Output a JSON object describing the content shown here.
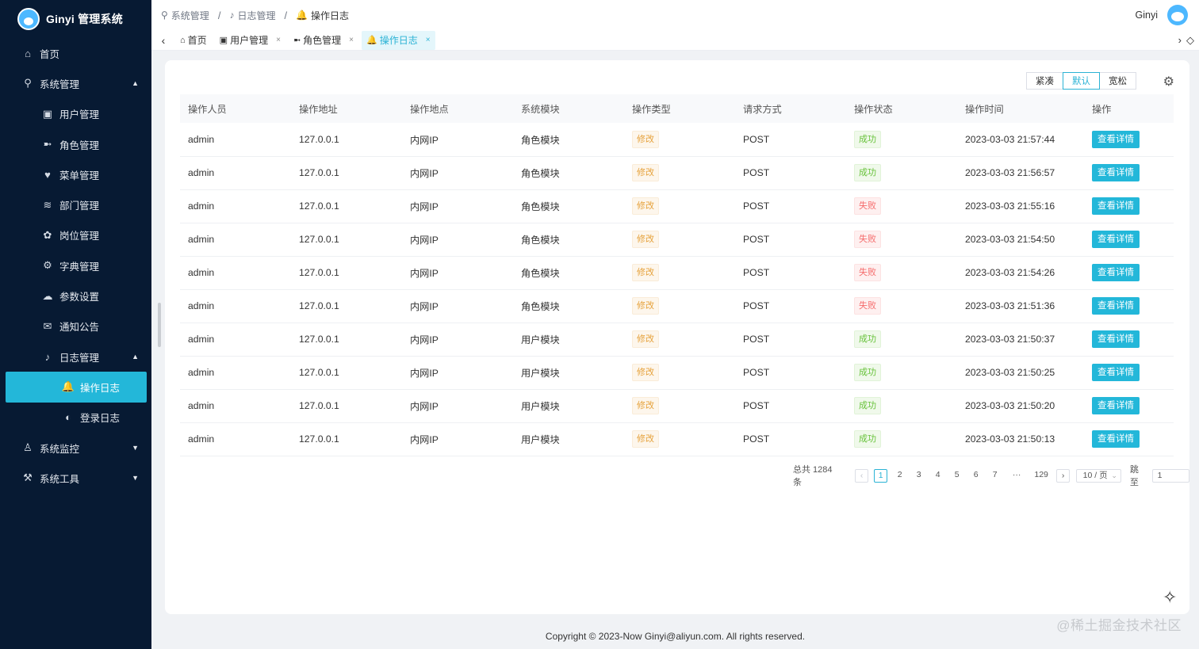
{
  "app": {
    "title": "Ginyi 管理系统"
  },
  "sidebar": {
    "items": [
      {
        "label": "首页",
        "icon": "home-icon",
        "glyph": "⌂",
        "level": 0
      },
      {
        "label": "系统管理",
        "icon": "person-icon",
        "glyph": "⚲",
        "level": 0,
        "expanded": true
      },
      {
        "label": "用户管理",
        "icon": "user-card-icon",
        "glyph": "▣",
        "level": 1
      },
      {
        "label": "角色管理",
        "icon": "role-icon",
        "glyph": "➼",
        "level": 1
      },
      {
        "label": "菜单管理",
        "icon": "heart-icon",
        "glyph": "♥",
        "level": 1
      },
      {
        "label": "部门管理",
        "icon": "layers-icon",
        "glyph": "≋",
        "level": 1
      },
      {
        "label": "岗位管理",
        "icon": "paw-icon",
        "glyph": "✿",
        "level": 1
      },
      {
        "label": "字典管理",
        "icon": "gear-icon",
        "glyph": "⚙",
        "level": 1
      },
      {
        "label": "参数设置",
        "icon": "wechat-icon",
        "glyph": "☁",
        "level": 1
      },
      {
        "label": "通知公告",
        "icon": "mail-icon",
        "glyph": "✉",
        "level": 1
      },
      {
        "label": "日志管理",
        "icon": "microphone-icon",
        "glyph": "♪",
        "level": 1,
        "expanded": true
      },
      {
        "label": "操作日志",
        "icon": "bell-icon",
        "glyph": "🔔",
        "level": 2,
        "active": true
      },
      {
        "label": "登录日志",
        "icon": "planet-icon",
        "glyph": "◐",
        "level": 2
      },
      {
        "label": "系统监控",
        "icon": "user-icon",
        "glyph": "♙",
        "level": 0,
        "collapsed": true
      },
      {
        "label": "系统工具",
        "icon": "wrench-icon",
        "glyph": "⚒",
        "level": 0,
        "collapsed": true
      }
    ]
  },
  "breadcrumb": [
    {
      "label": "系统管理",
      "icon": "person-icon",
      "glyph": "⚲"
    },
    {
      "label": "日志管理",
      "icon": "microphone-icon",
      "glyph": "♪"
    },
    {
      "label": "操作日志",
      "icon": "bell-icon",
      "glyph": "🔔"
    }
  ],
  "breadcrumb_separator": "/",
  "user": {
    "name": "Ginyi"
  },
  "tabs": [
    {
      "label": "首页",
      "icon": "home-icon",
      "glyph": "⌂",
      "closable": false
    },
    {
      "label": "用户管理",
      "icon": "user-card-icon",
      "glyph": "▣",
      "closable": true
    },
    {
      "label": "角色管理",
      "icon": "role-icon",
      "glyph": "➼",
      "closable": true
    },
    {
      "label": "操作日志",
      "icon": "bell-icon",
      "glyph": "🔔",
      "closable": true,
      "active": true
    }
  ],
  "density": {
    "options": [
      "紧凑",
      "默认",
      "宽松"
    ],
    "selected": "默认"
  },
  "table": {
    "columns": [
      "操作人员",
      "操作地址",
      "操作地点",
      "系统模块",
      "操作类型",
      "请求方式",
      "操作状态",
      "操作时间",
      "操作"
    ],
    "rows": [
      {
        "user": "admin",
        "ip": "127.0.0.1",
        "location": "内网IP",
        "module": "角色模块",
        "type": "修改",
        "method": "POST",
        "status": "成功",
        "status_kind": "ok",
        "time": "2023-03-03 21:57:44",
        "action": "查看详情"
      },
      {
        "user": "admin",
        "ip": "127.0.0.1",
        "location": "内网IP",
        "module": "角色模块",
        "type": "修改",
        "method": "POST",
        "status": "成功",
        "status_kind": "ok",
        "time": "2023-03-03 21:56:57",
        "action": "查看详情"
      },
      {
        "user": "admin",
        "ip": "127.0.0.1",
        "location": "内网IP",
        "module": "角色模块",
        "type": "修改",
        "method": "POST",
        "status": "失败",
        "status_kind": "fail",
        "time": "2023-03-03 21:55:16",
        "action": "查看详情"
      },
      {
        "user": "admin",
        "ip": "127.0.0.1",
        "location": "内网IP",
        "module": "角色模块",
        "type": "修改",
        "method": "POST",
        "status": "失败",
        "status_kind": "fail",
        "time": "2023-03-03 21:54:50",
        "action": "查看详情"
      },
      {
        "user": "admin",
        "ip": "127.0.0.1",
        "location": "内网IP",
        "module": "角色模块",
        "type": "修改",
        "method": "POST",
        "status": "失败",
        "status_kind": "fail",
        "time": "2023-03-03 21:54:26",
        "action": "查看详情"
      },
      {
        "user": "admin",
        "ip": "127.0.0.1",
        "location": "内网IP",
        "module": "角色模块",
        "type": "修改",
        "method": "POST",
        "status": "失败",
        "status_kind": "fail",
        "time": "2023-03-03 21:51:36",
        "action": "查看详情"
      },
      {
        "user": "admin",
        "ip": "127.0.0.1",
        "location": "内网IP",
        "module": "用户模块",
        "type": "修改",
        "method": "POST",
        "status": "成功",
        "status_kind": "ok",
        "time": "2023-03-03 21:50:37",
        "action": "查看详情"
      },
      {
        "user": "admin",
        "ip": "127.0.0.1",
        "location": "内网IP",
        "module": "用户模块",
        "type": "修改",
        "method": "POST",
        "status": "成功",
        "status_kind": "ok",
        "time": "2023-03-03 21:50:25",
        "action": "查看详情"
      },
      {
        "user": "admin",
        "ip": "127.0.0.1",
        "location": "内网IP",
        "module": "用户模块",
        "type": "修改",
        "method": "POST",
        "status": "成功",
        "status_kind": "ok",
        "time": "2023-03-03 21:50:20",
        "action": "查看详情"
      },
      {
        "user": "admin",
        "ip": "127.0.0.1",
        "location": "内网IP",
        "module": "用户模块",
        "type": "修改",
        "method": "POST",
        "status": "成功",
        "status_kind": "ok",
        "time": "2023-03-03 21:50:13",
        "action": "查看详情"
      }
    ]
  },
  "pagination": {
    "total_text": "总共 1284 条",
    "pages": [
      "1",
      "2",
      "3",
      "4",
      "5",
      "6",
      "7",
      "···",
      "129"
    ],
    "current": "1",
    "page_size": "10 / 页",
    "jump_label": "跳至",
    "jump_value": "1"
  },
  "footer": {
    "copyright": "Copyright © 2023-Now Ginyi@aliyun.com. All rights reserved."
  },
  "watermark": "@稀土掘金技术社区",
  "colors": {
    "sidebar_bg": "#071a33",
    "accent": "#23b7d9",
    "warning": "#e6a23c",
    "success": "#67c23a",
    "danger": "#f56c6c"
  }
}
